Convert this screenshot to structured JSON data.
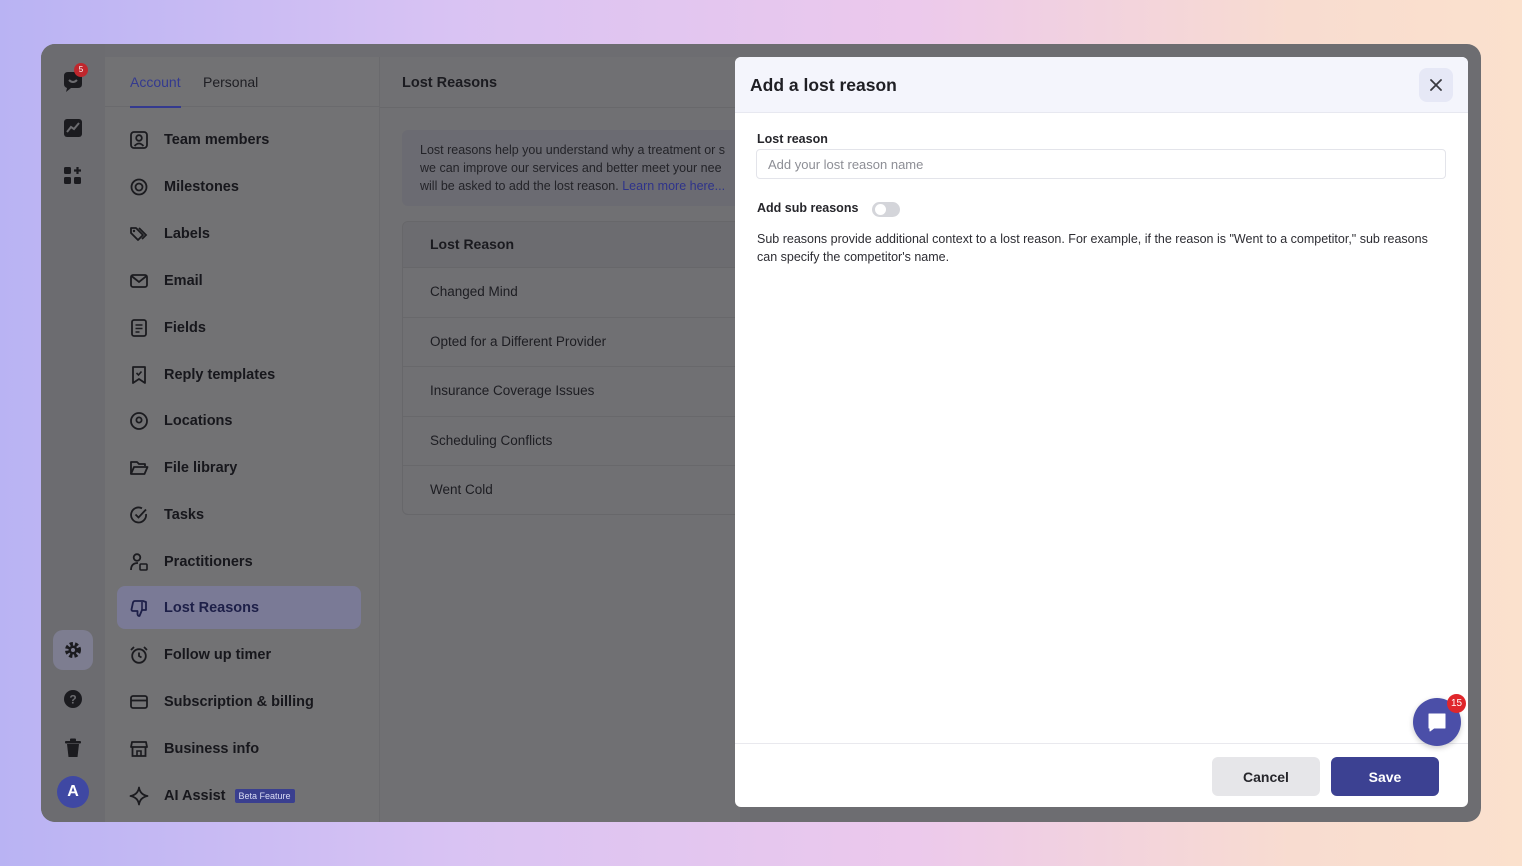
{
  "rail": {
    "logo_badge": "5",
    "avatar_initial": "A"
  },
  "nav": {
    "tabs": [
      {
        "label": "Account"
      },
      {
        "label": "Personal"
      }
    ],
    "items": [
      {
        "label": "Team members",
        "icon": "user-square-icon"
      },
      {
        "label": "Milestones",
        "icon": "target-icon"
      },
      {
        "label": "Labels",
        "icon": "tags-icon"
      },
      {
        "label": "Email",
        "icon": "mail-icon"
      },
      {
        "label": "Fields",
        "icon": "form-icon"
      },
      {
        "label": "Reply templates",
        "icon": "bookmark-icon"
      },
      {
        "label": "Locations",
        "icon": "map-pin-icon"
      },
      {
        "label": "File library",
        "icon": "folder-open-icon"
      },
      {
        "label": "Tasks",
        "icon": "check-circle-icon"
      },
      {
        "label": "Practitioners",
        "icon": "practitioner-icon"
      },
      {
        "label": "Lost Reasons",
        "icon": "thumbs-down-icon"
      },
      {
        "label": "Follow up timer",
        "icon": "alarm-clock-icon"
      },
      {
        "label": "Subscription & billing",
        "icon": "credit-card-icon"
      },
      {
        "label": "Business info",
        "icon": "store-icon"
      },
      {
        "label": "AI Assist",
        "icon": "sparkle-icon",
        "badge": "Beta Feature"
      }
    ]
  },
  "content": {
    "title": "Lost Reasons",
    "info_line1": "Lost reasons help you understand why a treatment or s",
    "info_line2": "we can improve our services and better meet your nee",
    "info_line3": "will be asked to add the lost reason.",
    "info_link": "Learn more here...",
    "table_header": "Lost Reason",
    "rows": [
      "Changed Mind",
      "Opted for a Different Provider",
      "Insurance Coverage Issues",
      "Scheduling Conflicts",
      "Went Cold"
    ]
  },
  "modal": {
    "title": "Add a lost reason",
    "field_label": "Lost reason",
    "field_placeholder": "Add your lost reason name",
    "field_value": "",
    "sub_label": "Add sub reasons",
    "sub_toggle_on": false,
    "helper_text": "Sub reasons provide additional context to a lost reason. For example, if the reason is \"Went to a competitor,\" sub reasons can specify the competitor's name.",
    "cancel_label": "Cancel",
    "save_label": "Save"
  },
  "chat": {
    "badge": "15"
  },
  "colors": {
    "accent": "#3c4192",
    "badge_red": "#e0262b"
  }
}
